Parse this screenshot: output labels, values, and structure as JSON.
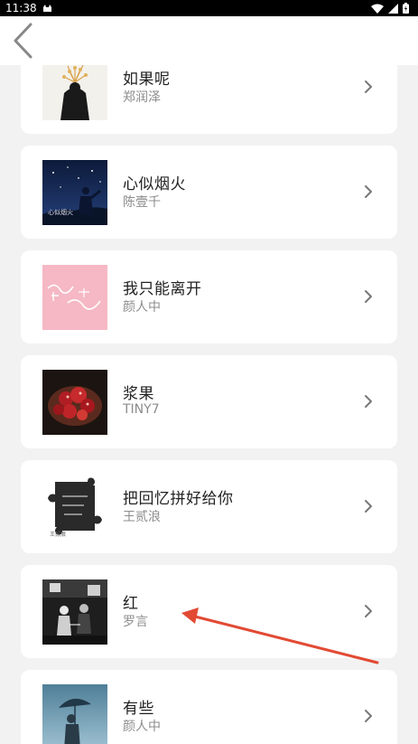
{
  "status": {
    "time": "11:38"
  },
  "colors": {
    "arrow": "#e24a33",
    "card_bg": "#ffffff",
    "page_bg": "#f2f2f2"
  },
  "songs": [
    {
      "title": "如果呢",
      "artist": "郑润泽"
    },
    {
      "title": "心似烟火",
      "artist": "陈壹千"
    },
    {
      "title": "我只能离开",
      "artist": "颜人中"
    },
    {
      "title": "浆果",
      "artist": "TINY7"
    },
    {
      "title": "把回忆拼好给你",
      "artist": "王贰浪"
    },
    {
      "title": "红",
      "artist": "罗言"
    },
    {
      "title": "有些",
      "artist": "颜人中"
    }
  ]
}
